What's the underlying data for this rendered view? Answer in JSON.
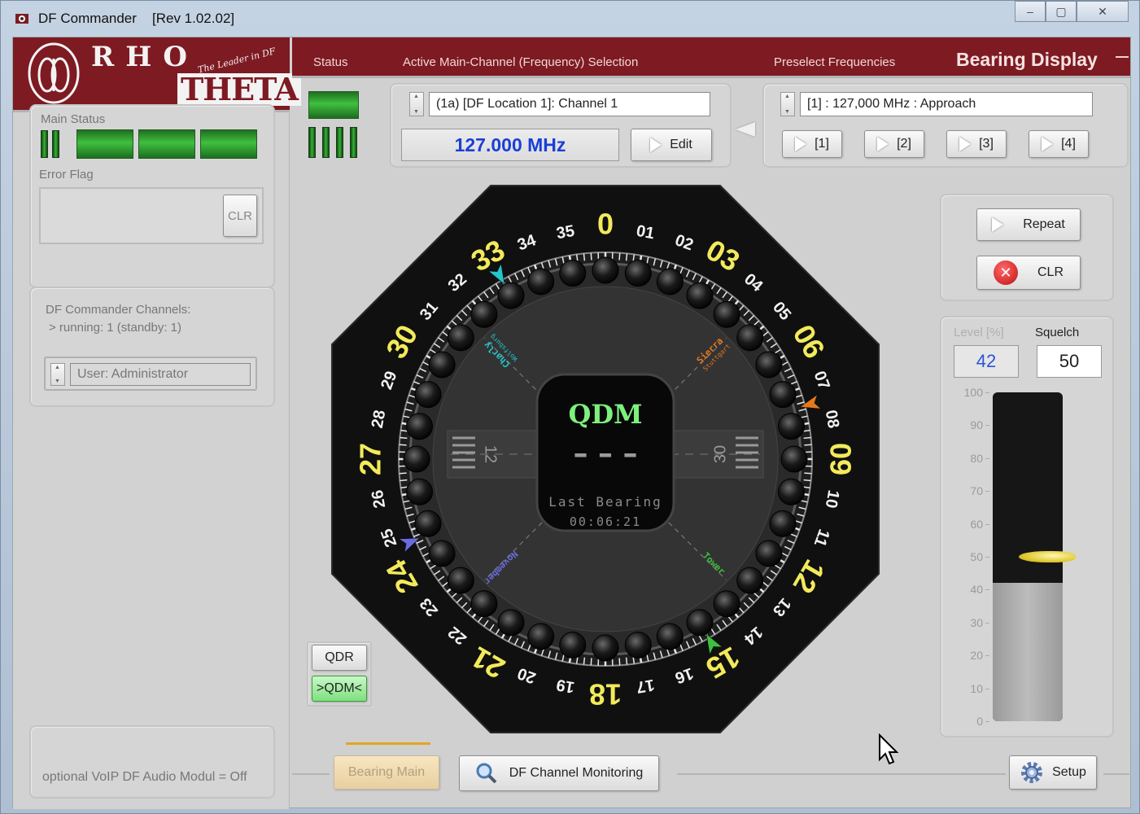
{
  "window": {
    "title": "DF Commander",
    "revision": "[Rev 1.02.02]",
    "controls": [
      "–",
      "▢",
      "✕"
    ]
  },
  "logo": {
    "brand_top": "RHO",
    "brand_bottom": "THETA",
    "tagline": "The Leader in DF"
  },
  "left": {
    "main_status_label": "Main Status",
    "error_flag_label": "Error Flag",
    "error_clr": "CLR",
    "channels_title": "DF Commander Channels:",
    "channels_detail": "> running: 1   (standby: 1)",
    "user_value": "User: Administrator",
    "voip_text": "optional VoIP DF Audio Modul = Off"
  },
  "header": {
    "status": "Status",
    "active_channel": "Active Main-Channel (Frequency) Selection",
    "preselect": "Preselect Frequencies",
    "display_title": "Bearing Display"
  },
  "channel": {
    "selection": "(1a) [DF Location 1]: Channel 1",
    "frequency": "127.000 MHz",
    "edit_label": "Edit"
  },
  "preselect": {
    "selection": "[1] : 127,000 MHz : Approach",
    "buttons": [
      "[1]",
      "[2]",
      "[3]",
      "[4]"
    ]
  },
  "compass": {
    "mode": "QDM",
    "reading": "– – –",
    "last_bearing_label": "Last Bearing",
    "last_bearing_time": "00:06:21",
    "runway_left": "12",
    "runway_right": "30",
    "labels": [
      {
        "number": "0",
        "deg": 0,
        "major": true
      },
      {
        "number": "01",
        "deg": 10,
        "major": false
      },
      {
        "number": "02",
        "deg": 20,
        "major": false
      },
      {
        "number": "03",
        "deg": 30,
        "major": true
      },
      {
        "number": "04",
        "deg": 40,
        "major": false
      },
      {
        "number": "05",
        "deg": 50,
        "major": false
      },
      {
        "number": "06",
        "deg": 60,
        "major": true
      },
      {
        "number": "07",
        "deg": 70,
        "major": false
      },
      {
        "number": "08",
        "deg": 80,
        "major": false
      },
      {
        "number": "09",
        "deg": 90,
        "major": true
      },
      {
        "number": "10",
        "deg": 100,
        "major": false
      },
      {
        "number": "11",
        "deg": 110,
        "major": false
      },
      {
        "number": "12",
        "deg": 120,
        "major": true
      },
      {
        "number": "13",
        "deg": 130,
        "major": false
      },
      {
        "number": "14",
        "deg": 140,
        "major": false
      },
      {
        "number": "15",
        "deg": 150,
        "major": true
      },
      {
        "number": "16",
        "deg": 160,
        "major": false
      },
      {
        "number": "17",
        "deg": 170,
        "major": false
      },
      {
        "number": "18",
        "deg": 180,
        "major": true
      },
      {
        "number": "19",
        "deg": 190,
        "major": false
      },
      {
        "number": "20",
        "deg": 200,
        "major": false
      },
      {
        "number": "21",
        "deg": 210,
        "major": true
      },
      {
        "number": "22",
        "deg": 220,
        "major": false
      },
      {
        "number": "23",
        "deg": 230,
        "major": false
      },
      {
        "number": "24",
        "deg": 240,
        "major": true
      },
      {
        "number": "25",
        "deg": 250,
        "major": false
      },
      {
        "number": "26",
        "deg": 260,
        "major": false
      },
      {
        "number": "27",
        "deg": 270,
        "major": true
      },
      {
        "number": "28",
        "deg": 280,
        "major": false
      },
      {
        "number": "29",
        "deg": 290,
        "major": false
      },
      {
        "number": "30",
        "deg": 300,
        "major": true
      },
      {
        "number": "31",
        "deg": 310,
        "major": false
      },
      {
        "number": "32",
        "deg": 320,
        "major": false
      },
      {
        "number": "33",
        "deg": 330,
        "major": true
      },
      {
        "number": "34",
        "deg": 340,
        "major": false
      },
      {
        "number": "35",
        "deg": 350,
        "major": false
      }
    ],
    "sites": [
      {
        "name": "Charly",
        "sub": "Wolfsburg",
        "deg": 315,
        "color": "#22c6cc"
      },
      {
        "name": "Sierra",
        "sub": "Stuttgart",
        "deg": 45,
        "color": "#e5781d"
      },
      {
        "name": "Tower",
        "sub": "",
        "deg": 135,
        "color": "#3fbf3f"
      },
      {
        "name": "November",
        "sub": "",
        "deg": 225,
        "color": "#6b6be0"
      }
    ],
    "markers": [
      {
        "deg": 330,
        "color": "#22c6cc"
      },
      {
        "deg": 75,
        "color": "#e5781d"
      },
      {
        "deg": 150,
        "color": "#3fbf3f"
      },
      {
        "deg": 247,
        "color": "#6b6be0"
      }
    ]
  },
  "actions": {
    "repeat": "Repeat",
    "clr": "CLR"
  },
  "level": {
    "level_label": "Level [%]",
    "squelch_label": "Squelch",
    "level_value": "42",
    "squelch_value": "50",
    "level_percent": 42,
    "squelch_percent": 50,
    "scale": [
      "100",
      "90",
      "80",
      "70",
      "60",
      "50",
      "40",
      "30",
      "20",
      "10",
      "0"
    ]
  },
  "mode_buttons": {
    "qdr": "QDR",
    "qdm": ">QDM<"
  },
  "bottom_tabs": {
    "bearing_main": "Bearing Main",
    "monitoring": "DF Channel Monitoring",
    "setup": "Setup"
  }
}
